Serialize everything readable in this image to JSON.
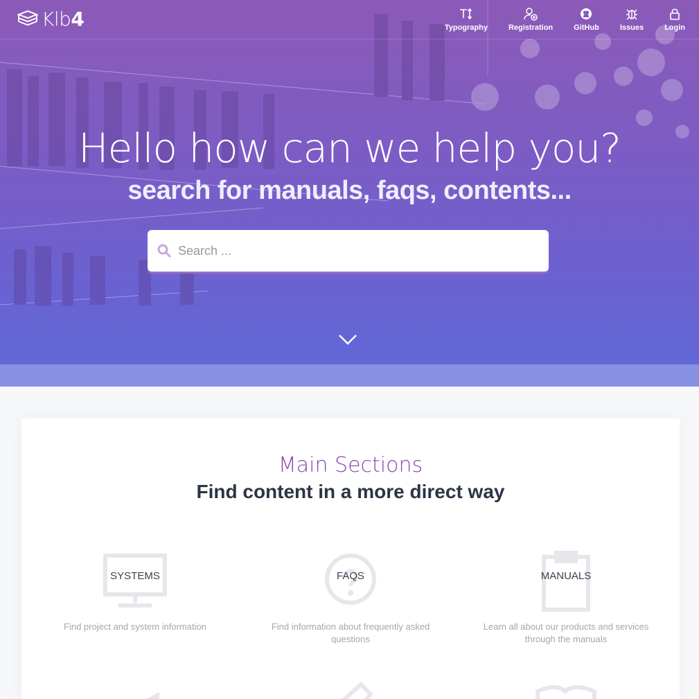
{
  "brand": {
    "name_light": "Klb",
    "name_bold": "4"
  },
  "nav": [
    {
      "label": "Typography",
      "icon": "text-size-icon"
    },
    {
      "label": "Registration",
      "icon": "add-user-icon"
    },
    {
      "label": "GitHub",
      "icon": "github-icon"
    },
    {
      "label": "Issues",
      "icon": "bug-icon"
    },
    {
      "label": "Login",
      "icon": "lock-icon"
    }
  ],
  "hero": {
    "title": "Hello how can we help you?",
    "subtitle": "search for manuals, faqs, contents...",
    "search_placeholder": "Search ..."
  },
  "sections": {
    "title": "Main Sections",
    "subtitle": "Find content in a more direct way",
    "items": [
      {
        "label": "SYSTEMS",
        "description": "Find project and system information",
        "icon": "monitor-icon"
      },
      {
        "label": "FAQS",
        "description": "Find information about frequently asked questions",
        "icon": "question-circle-icon"
      },
      {
        "label": "MANUALS",
        "description": "Learn all about our products and services through the manuals",
        "icon": "clipboard-icon"
      }
    ]
  },
  "colors": {
    "accent": "#8e44ad",
    "hero_top": "#8c5ab8",
    "hero_bottom": "#5f6ad8",
    "heading": "#2c3445"
  }
}
